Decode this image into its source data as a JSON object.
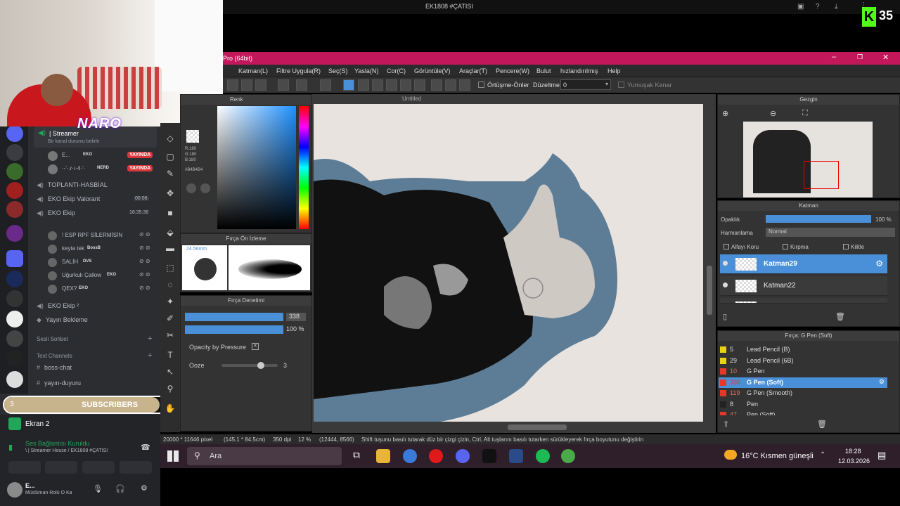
{
  "top": {
    "title": "EK1808 #ÇATISI",
    "kick_count": "35"
  },
  "overlay": {
    "brand": "NARO",
    "subs_label": "SUBSCRIBERS",
    "subs_left": "3",
    "subs_right": "4",
    "subs_fraction": 0.75
  },
  "discord": {
    "streaming_channel": "| Streamer",
    "status_hint": "Bir kanal durumu belirle",
    "members": [
      {
        "name": "E...",
        "tag": "EKO",
        "badge": "YAYINDA"
      },
      {
        "name": "·-'·.r·ı·4·'·",
        "tag": "NERD",
        "badge": "YAYINDA"
      }
    ],
    "channels": [
      {
        "label": "TOPLANTI-HASBİAL"
      },
      {
        "label": "EKO Ekip Valorant",
        "extra": "00 06"
      },
      {
        "label": "EKO Ekip",
        "extra": "18:35:36"
      }
    ],
    "sub_members": [
      {
        "name": "! ESP RPF SİLERMİSİN"
      },
      {
        "name": "keyta tek",
        "tag": "BossB"
      },
      {
        "name": "SALİH",
        "tag": "DVS"
      },
      {
        "name": "Uğurkulı Çallow",
        "tag": "EKO"
      },
      {
        "name": "QEX?",
        "tag": "EKO"
      }
    ],
    "more_channels": [
      {
        "label": "EKO Ekip ²"
      },
      {
        "label": "Yayın Bekleme"
      }
    ],
    "section_voice": "Sesli Sohbet",
    "section_text": "Text Channels",
    "text_channels": [
      "boss-chat",
      "yayın-duyuru"
    ],
    "screen_share": "Ekran 2",
    "voice_status": "Ses Bağlantısı Kuruldu",
    "voice_sub": "\\ | Streamer House / EK1808 #ÇATISI",
    "user_name": "E...",
    "user_status": "Müslüman Rolü O Ka"
  },
  "app": {
    "title": "Pro (64bit)",
    "menu": [
      "Katman(L)",
      "Filtre Uygula(R)",
      "Seç(S)",
      "Yasla(N)",
      "Cor(C)",
      "Görüntüle(V)",
      "Araçlar(T)",
      "Pencere(W)",
      "Bulut",
      "hızlandırılmış",
      "Help"
    ],
    "toolbar_ortusme": "Örtüşme-Önler",
    "toolbar_duzeltme": "Düzeltme",
    "toolbar_duzeltme_val": "0",
    "toolbar_kenar": "Yumuşak Kenar",
    "canvas_tab": "Untitled",
    "color_panel": {
      "title": "Renk",
      "r": "R:180",
      "g": "G:180",
      "b": "B:180",
      "hex": "#B4B4B4"
    },
    "brush_preview": {
      "title": "Fırça Ön İzleme",
      "size": "24.56mm"
    },
    "brush_control": {
      "title": "Fırça Denetimi",
      "size_val": "338",
      "opacity_val": "100 %",
      "opacity_pressure": "Opacity by Pressure",
      "ooze_label": "Ooze",
      "ooze_val": "3",
      "ooze_fraction": 0.7
    },
    "navigator": {
      "title": "Gezgin"
    },
    "layer_panel": {
      "title": "Katman",
      "opacity_label": "Opaklık",
      "opacity_val": "100 %",
      "blend_label": "Harmanlama",
      "blend_val": "Normal",
      "alpha_lock": "Alfayı Koru",
      "clip": "Kırpma",
      "lock": "Kilitle",
      "layers": [
        "Katman29",
        "Katman22",
        "Katman19"
      ]
    },
    "brush_panel": {
      "title": "Fırça: G Pen (Soft)",
      "brushes": [
        {
          "size": "5",
          "name": "Lead Pencil (B)",
          "color": "#e6d21a"
        },
        {
          "size": "29",
          "name": "Lead Pencil (6B)",
          "color": "#e6d21a"
        },
        {
          "size": "10",
          "name": "G Pen",
          "color": "#e03a2a"
        },
        {
          "size": "338",
          "name": "G Pen (Soft)",
          "color": "#e03a2a",
          "selected": true
        },
        {
          "size": "119",
          "name": "G Pen (Smooth)",
          "color": "#e03a2a"
        },
        {
          "size": "8",
          "name": "Pen",
          "color": "#222"
        },
        {
          "size": "47",
          "name": "Pen (Soft)",
          "color": "#e03a2a"
        }
      ]
    },
    "status": {
      "pixels": "20000 * 11646 pixel",
      "cm": "(145.1 * 84.5cm)",
      "dpi": "350 dpi",
      "zoom": "12 %",
      "coords": "(12444, 8566)",
      "hint": "Shift tuşunu basılı tutarak düz bir çizgi çizin, Ctrl, Alt tuşlarını basılı tutarken sürükleyerek fırça boyutunu değiştirin"
    }
  },
  "taskbar": {
    "search": "Ara",
    "weather": "16°C  Kısmen güneşli",
    "time": "18:28",
    "date": "12.03.2026"
  }
}
